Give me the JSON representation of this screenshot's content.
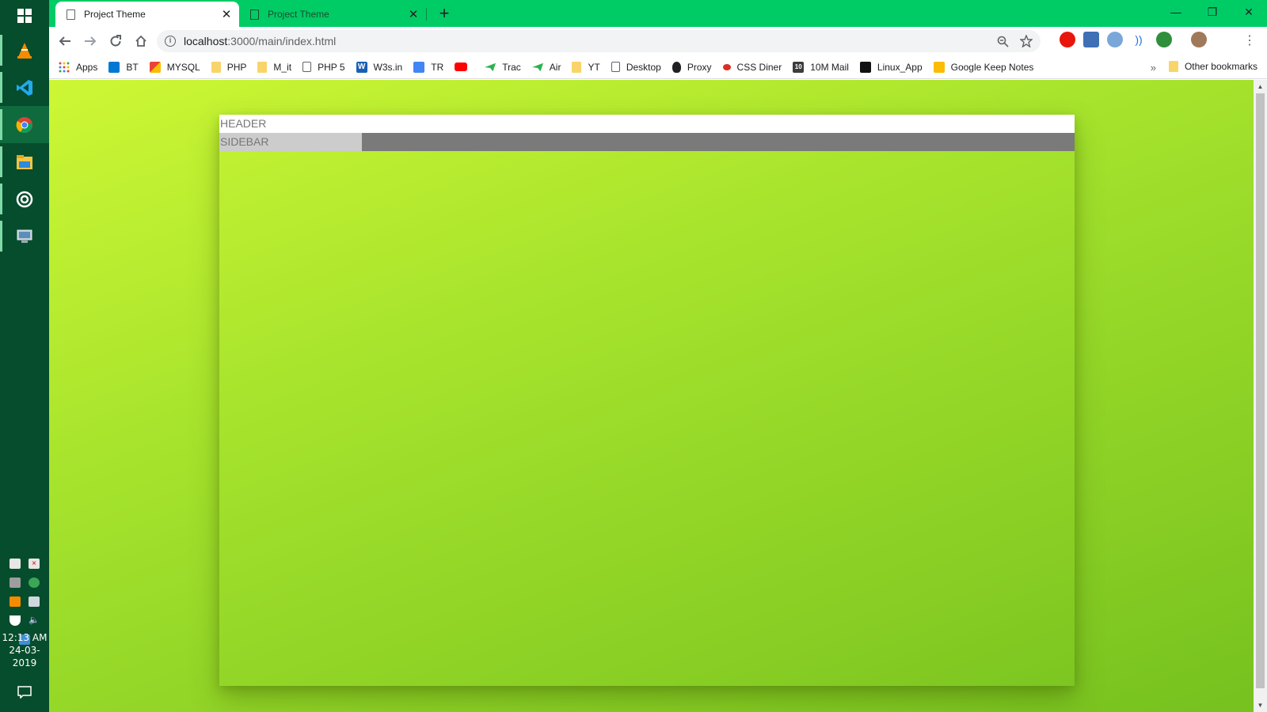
{
  "taskbar": {
    "apps": [
      "windows-start-icon",
      "vlc-icon",
      "vscode-icon",
      "chrome-icon",
      "file-explorer-icon",
      "target-app-icon",
      "remote-desktop-icon"
    ],
    "clock": {
      "time": "12:13 AM",
      "date": "24-03-2019"
    }
  },
  "browser": {
    "tabs": [
      {
        "title": "Project Theme",
        "active": true
      },
      {
        "title": "Project Theme",
        "active": false
      }
    ],
    "address": {
      "host": "localhost",
      "path": ":3000/main/index.html"
    },
    "bookmarks": [
      {
        "label": "Apps",
        "icon": "apps-grid-icon"
      },
      {
        "label": "BT",
        "icon": "bt-icon"
      },
      {
        "label": "MYSQL",
        "icon": "gmail-icon"
      },
      {
        "label": "PHP",
        "icon": "folder-icon"
      },
      {
        "label": "M_it",
        "icon": "folder-icon"
      },
      {
        "label": "PHP 5",
        "icon": "page-icon"
      },
      {
        "label": "W3s.in",
        "icon": "w-icon"
      },
      {
        "label": "TR",
        "icon": "translate-icon"
      },
      {
        "label": "",
        "icon": "youtube-icon"
      },
      {
        "label": "Trac",
        "icon": "send-icon"
      },
      {
        "label": "Air",
        "icon": "send-icon"
      },
      {
        "label": "YT",
        "icon": "folder-icon"
      },
      {
        "label": "Desktop",
        "icon": "page-icon"
      },
      {
        "label": "Proxy",
        "icon": "fire-icon"
      },
      {
        "label": "CSS Diner",
        "icon": "red-dot-icon"
      },
      {
        "label": "10M Mail",
        "icon": "tenmail-icon"
      },
      {
        "label": "Linux_App",
        "icon": "terminal-icon"
      },
      {
        "label": "Google Keep Notes",
        "icon": "keep-icon"
      }
    ],
    "more_bookmarks": "»",
    "other_bookmarks": "Other bookmarks"
  },
  "page": {
    "header": "HEADER",
    "sidebar": "SIDEBAR"
  },
  "colors": {
    "tabstrip": "#00cc66",
    "taskbar": "#064d2d",
    "header_bg": "#ffffff",
    "sidebar_bg": "#cccccc",
    "content_bar": "#7a7a7a"
  }
}
